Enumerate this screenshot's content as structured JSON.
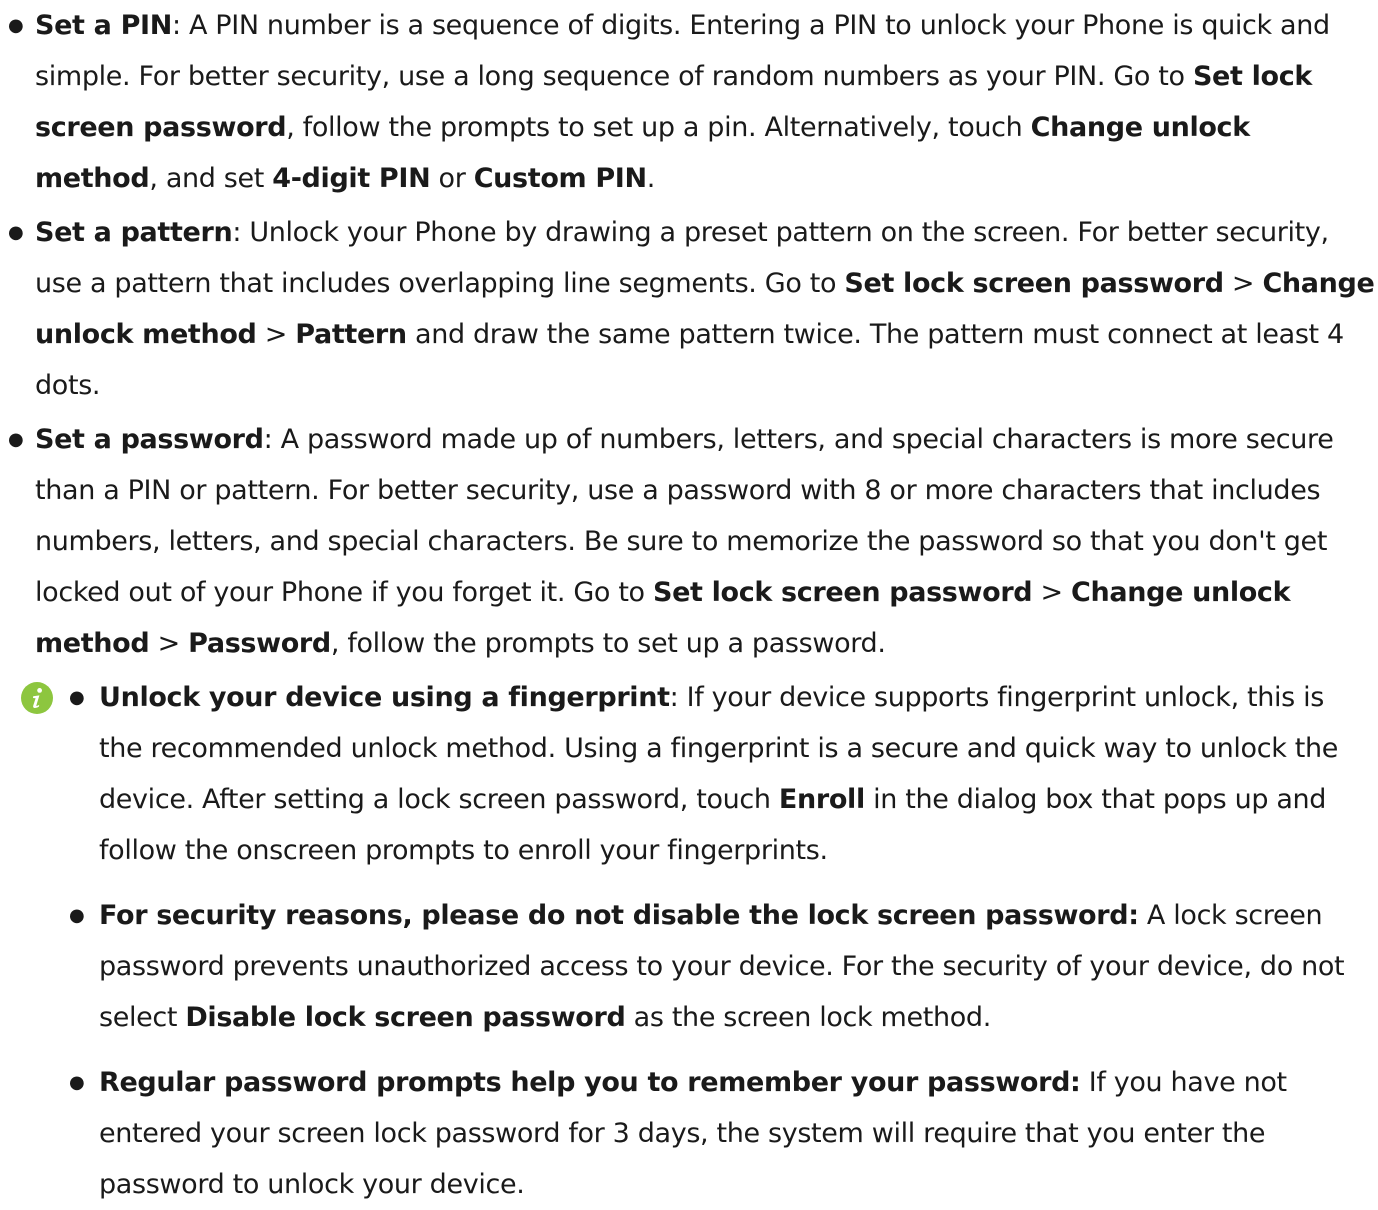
{
  "items": [
    {
      "title": "Set a PIN",
      "sep": ": ",
      "segments": [
        {
          "t": "A PIN number is a sequence of digits. Entering a PIN to unlock your Phone is quick and simple. For better security, use a long sequence of random numbers as your PIN. Go to "
        },
        {
          "t": "Set lock screen password",
          "b": true
        },
        {
          "t": ", follow the prompts to set up a pin. Alternatively, touch "
        },
        {
          "t": "Change unlock method",
          "b": true
        },
        {
          "t": ", and set "
        },
        {
          "t": "4-digit PIN",
          "b": true
        },
        {
          "t": " or "
        },
        {
          "t": "Custom PIN",
          "b": true
        },
        {
          "t": "."
        }
      ]
    },
    {
      "title": "Set a pattern",
      "sep": ": ",
      "segments": [
        {
          "t": "Unlock your Phone by drawing a preset pattern on the screen. For better security, use a pattern that includes overlapping line segments. Go to "
        },
        {
          "t": "Set lock screen password",
          "b": true
        },
        {
          "t": " > "
        },
        {
          "t": "Change unlock method",
          "b": true
        },
        {
          "t": " > "
        },
        {
          "t": "Pattern",
          "b": true
        },
        {
          "t": " and draw the same pattern twice. The pattern must connect at least 4 dots."
        }
      ]
    },
    {
      "title": "Set a password",
      "sep": ": ",
      "segments": [
        {
          "t": "A password made up of numbers, letters, and special characters is more secure than a PIN or pattern. For better security, use a password with 8 or more characters that includes numbers, letters, and special characters. Be sure to memorize the password so that you don't get locked out of your Phone if you forget it. Go to "
        },
        {
          "t": "Set lock screen password",
          "b": true
        },
        {
          "t": " > "
        },
        {
          "t": "Change unlock method",
          "b": true
        },
        {
          "t": " > "
        },
        {
          "t": "Password",
          "b": true
        },
        {
          "t": ", follow the prompts to set up a password."
        }
      ]
    }
  ],
  "note": {
    "icon": "info-icon",
    "icon_color": "#8dc63f",
    "items": [
      {
        "title": "Unlock your device using a fingerprint",
        "sep": ": ",
        "segments": [
          {
            "t": "If your device supports fingerprint unlock, this is the recommended unlock method. Using a fingerprint is a secure and quick way to unlock the device. After setting a lock screen password, touch "
          },
          {
            "t": "Enroll",
            "b": true
          },
          {
            "t": " in the dialog box that pops up and follow the onscreen prompts to enroll your fingerprints."
          }
        ]
      },
      {
        "title": "For security reasons, please do not disable the lock screen password:",
        "sep": " ",
        "segments": [
          {
            "t": "A lock screen password prevents unauthorized access to your device. For the security of your device, do not select "
          },
          {
            "t": "Disable lock screen password",
            "b": true
          },
          {
            "t": " as the screen lock method."
          }
        ]
      },
      {
        "title": "Regular password prompts help you to remember your password:",
        "sep": " ",
        "segments": [
          {
            "t": "If you have not entered your screen lock password for 3 days, the system will require that you enter the password to unlock your device."
          }
        ]
      }
    ]
  }
}
